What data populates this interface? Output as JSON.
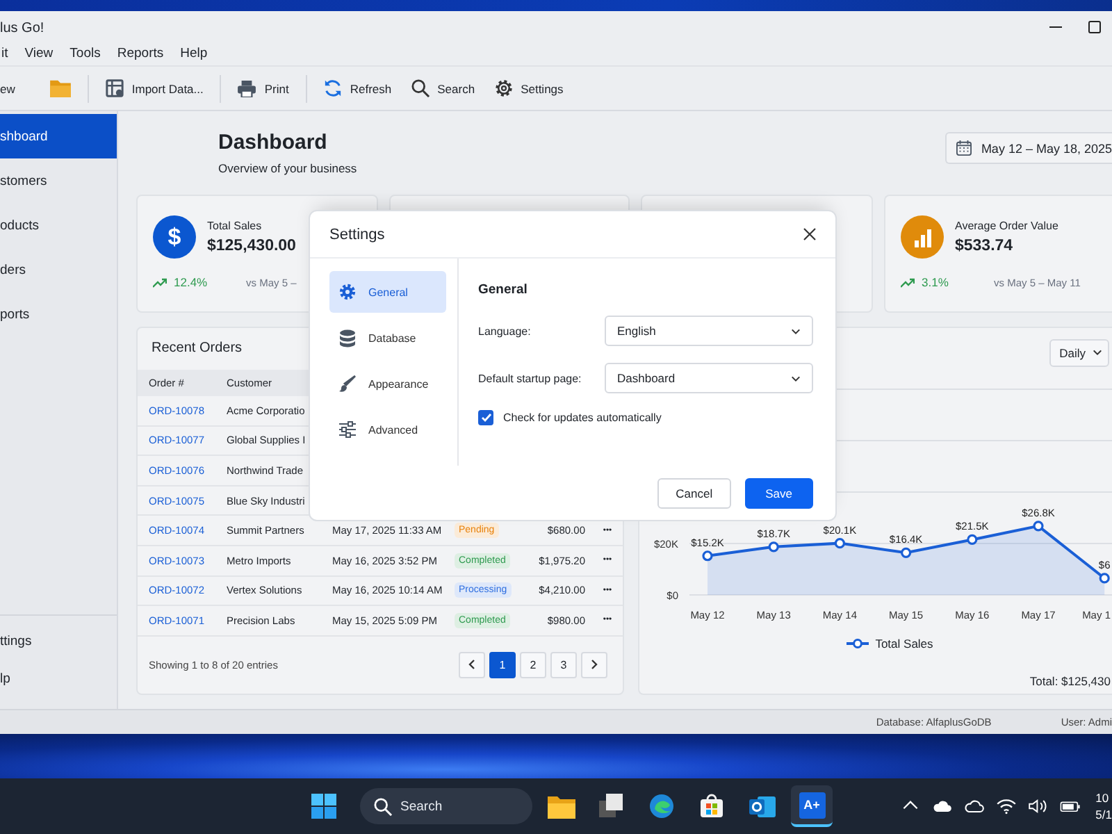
{
  "window": {
    "title": "lus Go!"
  },
  "menu": [
    {
      "label": "it"
    },
    {
      "label": "View"
    },
    {
      "label": "Tools"
    },
    {
      "label": "Reports"
    },
    {
      "label": "Help"
    }
  ],
  "toolbar": [
    {
      "kind": "button",
      "label": "ew"
    },
    {
      "kind": "icon-button"
    },
    {
      "kind": "separator"
    },
    {
      "kind": "button",
      "label": "Import Data..."
    },
    {
      "kind": "separator"
    },
    {
      "kind": "button",
      "label": "Print"
    },
    {
      "kind": "separator"
    },
    {
      "kind": "button",
      "label": "Refresh"
    },
    {
      "kind": "button",
      "label": "Search"
    },
    {
      "kind": "button",
      "label": "Settings"
    }
  ],
  "sidebar": {
    "items": [
      {
        "label": "shboard",
        "selected": true
      },
      {
        "label": "stomers",
        "selected": false
      },
      {
        "label": "oducts",
        "selected": false
      },
      {
        "label": "ders",
        "selected": false
      },
      {
        "label": "ports",
        "selected": false
      }
    ],
    "footer_items": [
      {
        "label": "ttings"
      },
      {
        "label": "lp"
      }
    ]
  },
  "header": {
    "title": "Dashboard",
    "subtitle": "Overview of your business",
    "date_range": "May 12 – May 18, 2025"
  },
  "stats": [
    {
      "kind": "stat",
      "symbol": "$",
      "label": "Total Sales",
      "value": "$125,430.00",
      "change": "12.4%",
      "comparison": "vs May 5 –",
      "color": "#0b57d0"
    },
    {
      "kind": "covered"
    },
    {
      "kind": "covered"
    },
    {
      "kind": "stat",
      "label": "Average Order Value",
      "value": "$533.74",
      "change": "3.1%",
      "comparison": "vs May 5 – May 11",
      "color": "#e08b0b"
    }
  ],
  "orders": {
    "title": "Recent Orders",
    "columns": [
      "Order #",
      "Customer"
    ],
    "rows": [
      {
        "order": "ORD-10078",
        "customer": "Acme Corporatio"
      },
      {
        "order": "ORD-10077",
        "customer": "Global Supplies I"
      },
      {
        "order": "ORD-10076",
        "customer": "Northwind Trade"
      },
      {
        "order": "ORD-10075",
        "customer": "Blue Sky Industri"
      },
      {
        "order": "ORD-10074",
        "customer": "Summit Partners",
        "date": "May 17, 2025 11:33 AM",
        "status": "Pending",
        "color": "#e8820c",
        "amount": "$680.00",
        "actions": "•••"
      },
      {
        "order": "ORD-10073",
        "customer": "Metro Imports",
        "date": "May 16, 2025 3:52 PM",
        "status": "Completed",
        "color": "#2e9a4f",
        "amount": "$1,975.20",
        "actions": "•••"
      },
      {
        "order": "ORD-10072",
        "customer": "Vertex Solutions",
        "date": "May 16, 2025 10:14 AM",
        "status": "Processing",
        "color": "#2f6fe0",
        "amount": "$4,210.00",
        "actions": "•••"
      },
      {
        "order": "ORD-10071",
        "customer": "Precision Labs",
        "date": "May 15, 2025 5:09 PM",
        "status": "Completed",
        "color": "#2e9a4f",
        "amount": "$980.00",
        "actions": "•••"
      }
    ],
    "summary": "Showing 1 to 8 of 20 entries",
    "pages": [
      {
        "label": "1",
        "selected": true
      },
      {
        "label": "2",
        "selected": false
      },
      {
        "label": "3",
        "selected": false
      }
    ]
  },
  "chart": {
    "period": "Daily",
    "chart_data": {
      "type": "area",
      "categories": [
        "May 12",
        "May 13",
        "May 14",
        "May 15",
        "May 16",
        "May 17",
        "May 1"
      ],
      "series": [
        {
          "name": "Total Sales",
          "color": "#1a5fd6",
          "values": [
            15.2,
            18.7,
            20.1,
            16.4,
            21.5,
            26.8,
            6.5
          ]
        }
      ],
      "ylim": [
        0,
        80
      ],
      "yticks": [
        {
          "value": 0,
          "label": "$0"
        },
        {
          "value": 20,
          "label": "$20K"
        }
      ],
      "value_labels": [
        "$15.2K",
        "$18.7K",
        "$20.1K",
        "$16.4K",
        "$21.5K",
        "$26.8K",
        "$6"
      ]
    },
    "total": "Total: $125,430"
  },
  "status_bar": [
    {
      "text": "Database: AlfaplusGoDB"
    },
    {
      "text": "User: Admi"
    }
  ],
  "settings_dialog": {
    "title": "Settings",
    "nav": [
      {
        "label": "General",
        "selected": true
      },
      {
        "label": "Database",
        "selected": false
      },
      {
        "label": "Appearance",
        "selected": false
      },
      {
        "label": "Advanced",
        "selected": false
      }
    ],
    "section_title": "General",
    "fields": [
      {
        "label": "Language:",
        "value": "English"
      },
      {
        "label": "Default startup page:",
        "value": "Dashboard"
      }
    ],
    "checkbox": {
      "label": "Check for updates automatically",
      "checked": true
    },
    "buttons": [
      {
        "kind": "secondary",
        "label": "Cancel"
      },
      {
        "kind": "primary",
        "label": "Save"
      }
    ]
  },
  "taskbar": {
    "search_placeholder": "Search",
    "apps": [
      {
        "selected": false
      },
      {
        "selected": false
      },
      {
        "selected": false
      },
      {
        "selected": false
      },
      {
        "selected": false
      },
      {
        "label": "A+",
        "selected": true
      }
    ],
    "clock": {
      "time": "10",
      "date": "5/1"
    }
  }
}
